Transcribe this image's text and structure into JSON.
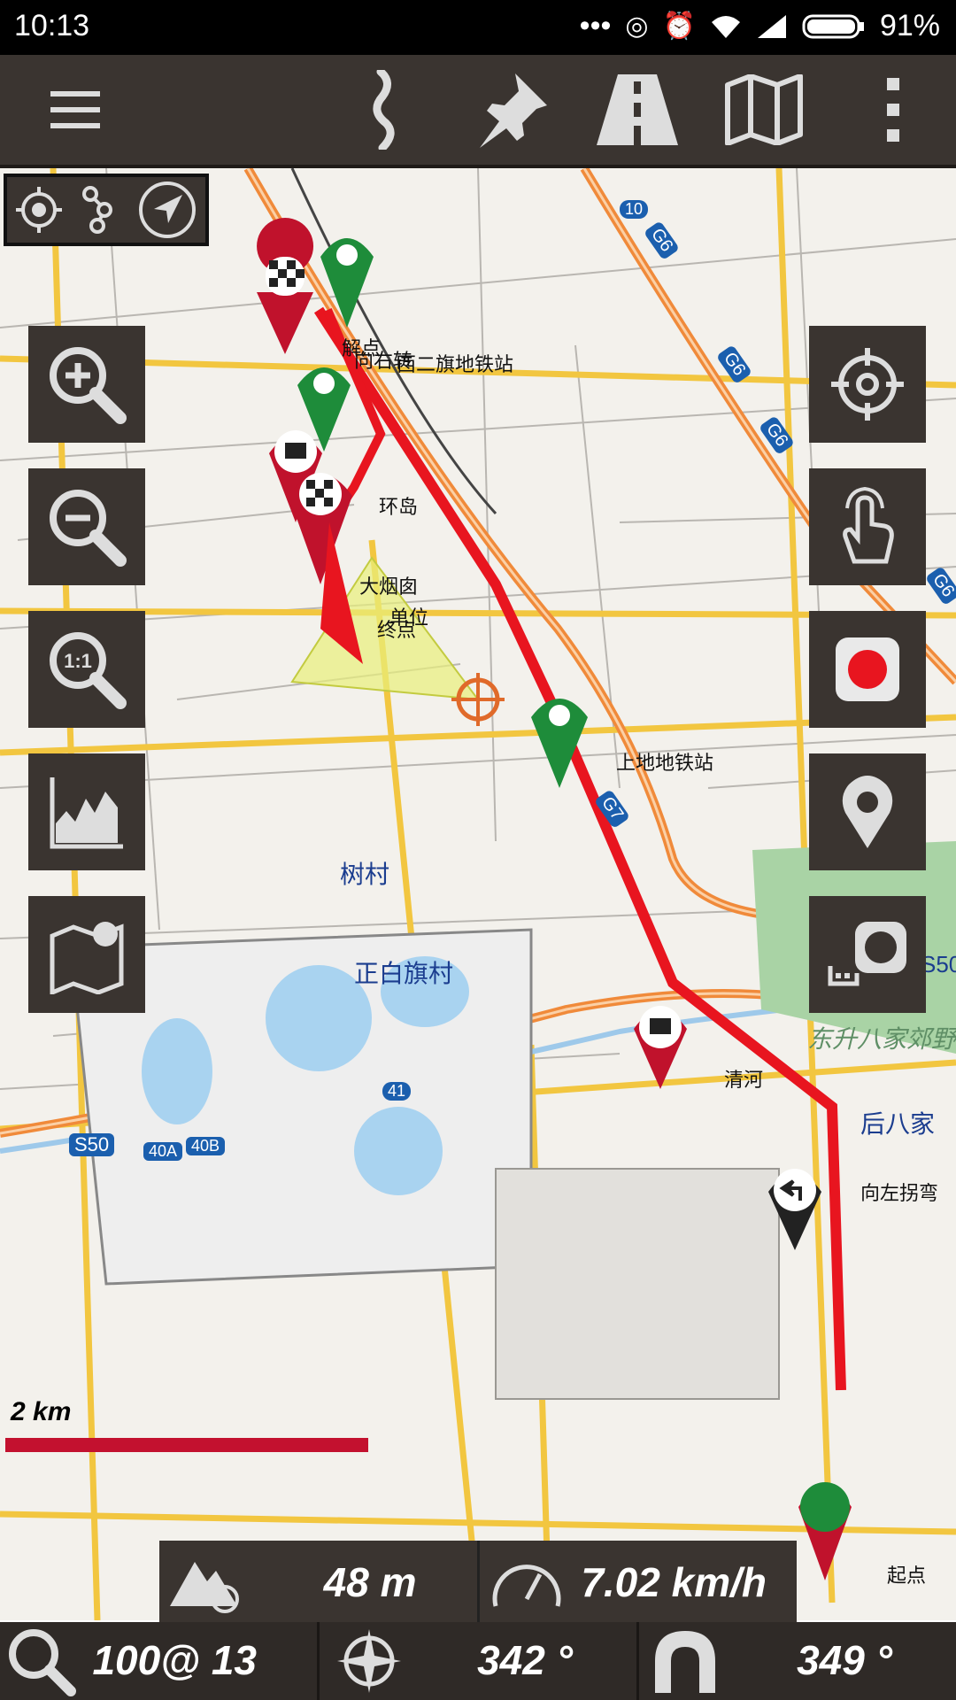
{
  "status_bar": {
    "time": "10:13",
    "dots": "•••",
    "battery": "91%"
  },
  "toolbar": {
    "icons": [
      "menu-icon",
      "route-icon",
      "pin-icon",
      "road-icon",
      "map-icon",
      "more-icon"
    ]
  },
  "mode_bar": {
    "icons": [
      "gps-icon",
      "track-nodes-icon",
      "navigation-arrow-icon"
    ]
  },
  "left_buttons": [
    "zoom-in-icon",
    "zoom-out-icon",
    "zoom-1to1-icon",
    "elevation-chart-icon",
    "map-layers-icon"
  ],
  "right_buttons": [
    "target-icon",
    "touch-icon",
    "record-icon",
    "waypoint-icon",
    "camera-icon"
  ],
  "map_labels": {
    "l1": "西二旗地铁站",
    "l2": "解点",
    "l3": "向右转",
    "l4": "环岛",
    "l5": "大烟囱",
    "l6": "单位",
    "l7": "终点",
    "l8": "上地地铁站",
    "l9": "树村",
    "l10": "正白旗村",
    "l11": "东升八家郊野",
    "l12": "清河",
    "l13": "后八家",
    "l14": "向左拐弯",
    "l15": "起点",
    "r1": "10",
    "r2": "G6",
    "r3": "G6",
    "r4": "G6",
    "r5": "G6",
    "r6": "G7",
    "r7": "S50",
    "r8": "40A",
    "r9": "40B",
    "r10": "41",
    "r11": "S50"
  },
  "scale": {
    "label": "2 km"
  },
  "info": {
    "altitude": "48 m",
    "speed": "7.02 km/h"
  },
  "bottom_bar": {
    "zoom": "100@ 13",
    "bearing": "342 °",
    "heading": "349 °"
  },
  "colors": {
    "toolbar": "#3a3430",
    "route": "#e8151f",
    "marker_green": "#1e8c3a",
    "marker_red": "#c0122c"
  }
}
